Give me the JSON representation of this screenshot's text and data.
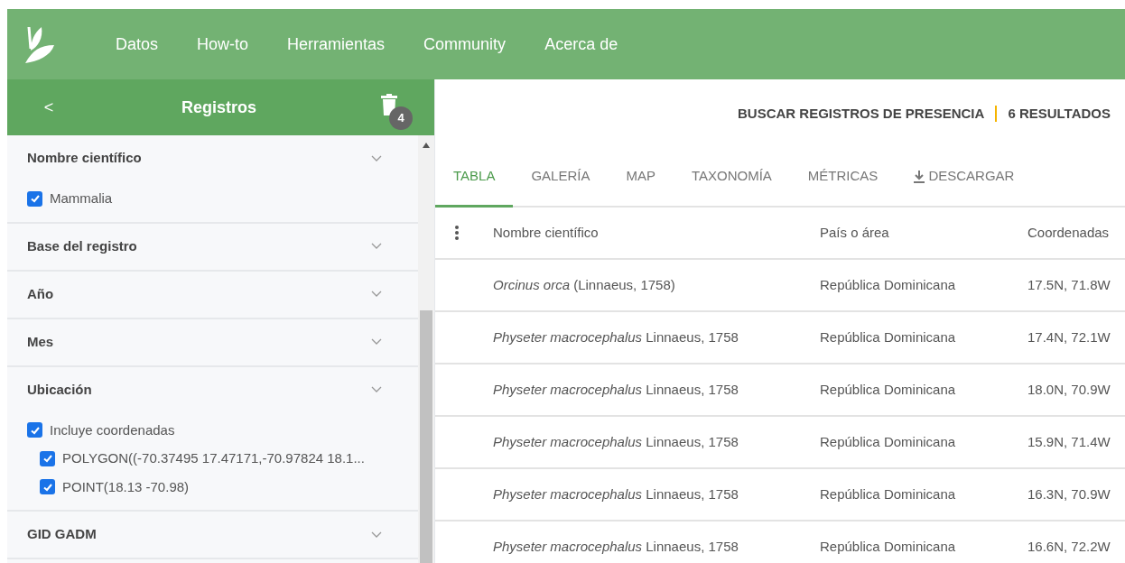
{
  "nav": {
    "items": [
      "Datos",
      "How-to",
      "Herramientas",
      "Community",
      "Acerca de"
    ]
  },
  "sidebar": {
    "back": "<",
    "title": "Registros",
    "badge": "4",
    "filters": [
      {
        "title": "Nombre científico",
        "options": [
          {
            "label": "Mammalia",
            "checked": true
          }
        ]
      },
      {
        "title": "Base del registro"
      },
      {
        "title": "Año"
      },
      {
        "title": "Mes"
      },
      {
        "title": "Ubicación",
        "options": [
          {
            "label": "Incluye coordenadas",
            "checked": true,
            "children": [
              {
                "label": "POLYGON((-70.37495 17.47171,-70.97824 18.1...",
                "checked": true
              },
              {
                "label": "POINT(18.13 -70.98)",
                "checked": true
              }
            ]
          }
        ]
      },
      {
        "title": "GID GADM"
      }
    ]
  },
  "summary": {
    "title": "BUSCAR REGISTROS DE PRESENCIA",
    "count": "6 RESULTADOS"
  },
  "tabs": [
    {
      "label": "TABLA",
      "selected": true,
      "kind": "tab"
    },
    {
      "label": "GALERÍA",
      "selected": false,
      "kind": "tab"
    },
    {
      "label": "MAP",
      "selected": false,
      "kind": "tab"
    },
    {
      "label": "TAXONOMÍA",
      "selected": false,
      "kind": "tab"
    },
    {
      "label": "MÉTRICAS",
      "selected": false,
      "kind": "tab"
    },
    {
      "label": "DESCARGAR",
      "selected": false,
      "kind": "download"
    }
  ],
  "table": {
    "columns": [
      "Nombre científico",
      "País o área",
      "Coordenadas"
    ],
    "rows": [
      [
        "*Orcinus orca* (Linnaeus, 1758)",
        "República Dominicana",
        "17.5N, 71.8W"
      ],
      [
        "*Physeter macrocephalus* Linnaeus, 1758",
        "República Dominicana",
        "17.4N, 72.1W"
      ],
      [
        "*Physeter macrocephalus* Linnaeus, 1758",
        "República Dominicana",
        "18.0N, 70.9W"
      ],
      [
        "*Physeter macrocephalus* Linnaeus, 1758",
        "República Dominicana",
        "15.9N, 71.4W"
      ],
      [
        "*Physeter macrocephalus* Linnaeus, 1758",
        "República Dominicana",
        "16.3N, 70.9W"
      ],
      [
        "*Physeter macrocephalus* Linnaeus, 1758",
        "República Dominicana",
        "16.6N, 72.2W"
      ]
    ]
  }
}
